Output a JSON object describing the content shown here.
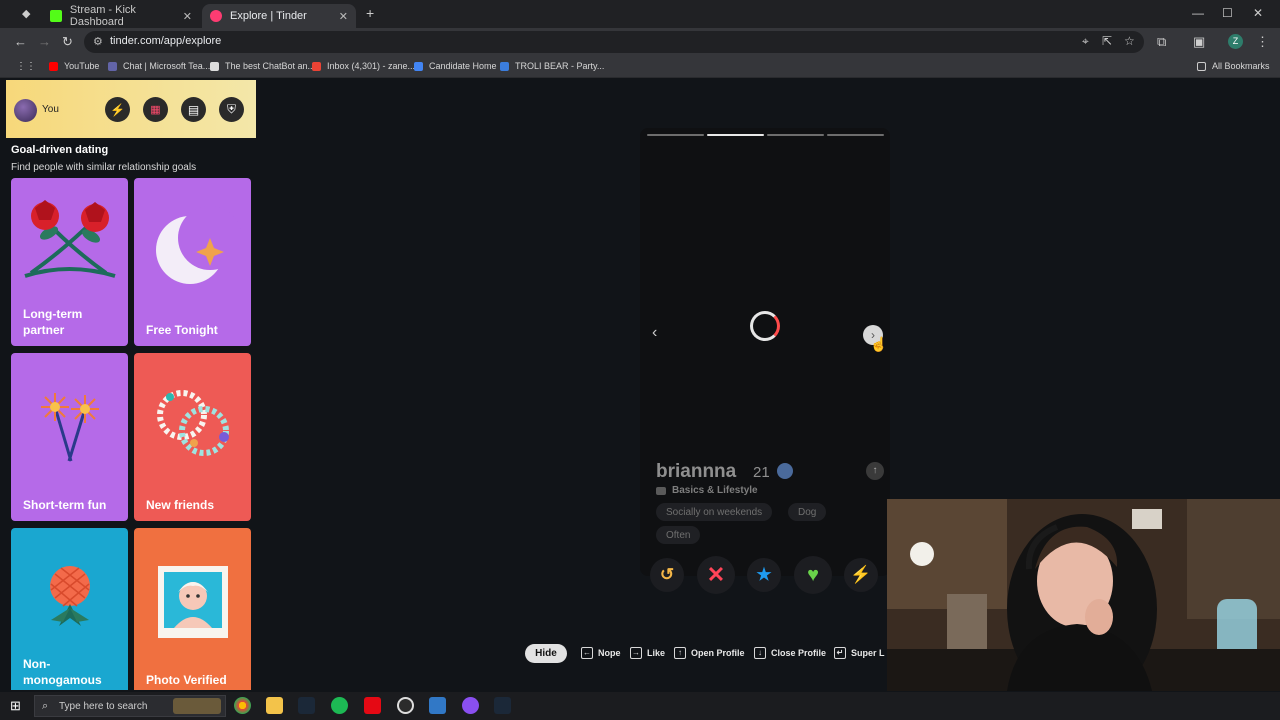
{
  "browser": {
    "tabs": [
      {
        "title": "Stream - Kick Dashboard",
        "active": false,
        "color": "#53fc18"
      },
      {
        "title": "Explore | Tinder",
        "active": true,
        "color": "#fe3c72"
      }
    ],
    "new_tab_glyph": "+",
    "url": "tinder.com/app/explore",
    "bookmarks": [
      {
        "label": "YouTube",
        "color": "#ff0000"
      },
      {
        "label": "Chat | Microsoft Tea...",
        "color": "#6264a7"
      },
      {
        "label": "The best ChatBot an...",
        "color": "#dddddd"
      },
      {
        "label": "Inbox (4,301) - zane...",
        "color": "#ea4335"
      },
      {
        "label": "Candidate Home",
        "color": "#4285f4"
      },
      {
        "label": "TROLI BEAR - Party...",
        "color": "#3b7ddd"
      }
    ],
    "all_bookmarks": "All Bookmarks",
    "profile_initial": "Z"
  },
  "sidebar": {
    "you_label": "You",
    "section_title": "Goal-driven dating",
    "section_subtitle": "Find people with similar relationship goals",
    "cards": [
      {
        "label": "Long-term partner",
        "bg": "#b56ae8",
        "icon": "roses-icon"
      },
      {
        "label": "Free Tonight",
        "bg": "#b56ae8",
        "icon": "moon-icon"
      },
      {
        "label": "Short-term fun",
        "bg": "#b56ae8",
        "icon": "sparklers-icon"
      },
      {
        "label": "New friends",
        "bg": "#ee5a55",
        "icon": "bracelets-icon"
      },
      {
        "label": "Non-monogamous",
        "bg": "#1aa7d0",
        "icon": "pineapple-icon"
      },
      {
        "label": "Photo Verified",
        "bg": "#f07040",
        "icon": "portrait-icon"
      }
    ]
  },
  "profile": {
    "name": "briannna",
    "age": "21",
    "photo_count": 4,
    "active_photo": 2,
    "section": "Basics & Lifestyle",
    "chips": [
      "Socially on weekends",
      "Dog",
      "Often"
    ]
  },
  "shortcuts": {
    "hide": "Hide",
    "items": [
      {
        "key": "←",
        "label": "Nope"
      },
      {
        "key": "→",
        "label": "Like"
      },
      {
        "key": "↑",
        "label": "Open Profile"
      },
      {
        "key": "↓",
        "label": "Close Profile"
      },
      {
        "key": "↵",
        "label": "Super L"
      }
    ]
  },
  "taskbar": {
    "search_placeholder": "Type here to search"
  },
  "colors": {
    "accent": "#fe3c72",
    "nope": "#ff4458",
    "like": "#69d34a",
    "super_like": "#1e9bf0",
    "rewind": "#f5b748",
    "boost": "#a64ff5"
  }
}
